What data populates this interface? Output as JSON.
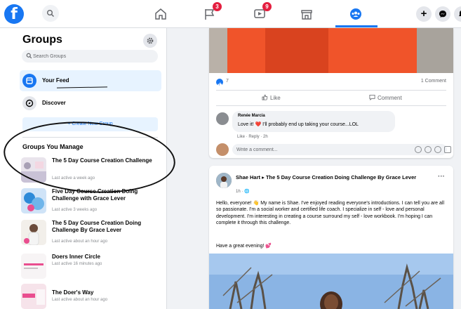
{
  "topbar": {
    "logo": "f",
    "icons": [
      "search-icon",
      "home-icon",
      "pages-icon",
      "watch-icon",
      "marketplace-icon",
      "groups-icon"
    ],
    "badges": {
      "pages": "3",
      "watch": "9"
    },
    "create_label": "+",
    "accent": "#1877f2",
    "badge_color": "#e41e3f"
  },
  "sidebar": {
    "title": "Groups",
    "search_placeholder": "Search Groups",
    "nav": [
      {
        "label": "Your Feed",
        "active": true
      },
      {
        "label": "Discover",
        "active": false
      }
    ],
    "create_label": "+ Create New Group",
    "section_title": "Groups You Manage",
    "groups": [
      {
        "name": "The 5 Day Course Creation Challenge",
        "activity": "Last active a week ago"
      },
      {
        "name": "Five Day Course Creation Doing Challenge with Grace Lever",
        "activity": "Last active 3 weeks ago"
      },
      {
        "name": "The 5 Day Course Creation Doing Challenge By Grace Lever",
        "activity": "Last active about an hour ago"
      },
      {
        "name": "Doers Inner Circle",
        "activity": "Last active 16 minutes ago"
      },
      {
        "name": "The Doer's Way",
        "activity": "Last active about an hour ago"
      }
    ]
  },
  "post1": {
    "like_count": "7",
    "comment_count": "1 Comment",
    "like_label": "Like",
    "comment_label": "Comment",
    "comment": {
      "author": "Renée Marcia",
      "text": "Love it! ❤️ I'll probably end up taking your course...LOL",
      "meta": "Like · Reply · 2h"
    },
    "write_placeholder": "Write a comment..."
  },
  "post2": {
    "author": "Shae Hart ▸ The 5 Day Course Creation Doing Challenge By Grace Lever",
    "time": "1h · 🌐",
    "more": "···",
    "body": "Hello, everyone! 👋 My name is Shae. I've enjoyed reading everyone's introductions. I can tell you are all so passionate. I'm a social worker and certified life coach. I specialize in self - love and personal development. I'm interesting in creating a course surround my self - love workbook. I'm hoping I can complete it through this challenge.",
    "sign_off": "Have a great evening! 💕"
  }
}
